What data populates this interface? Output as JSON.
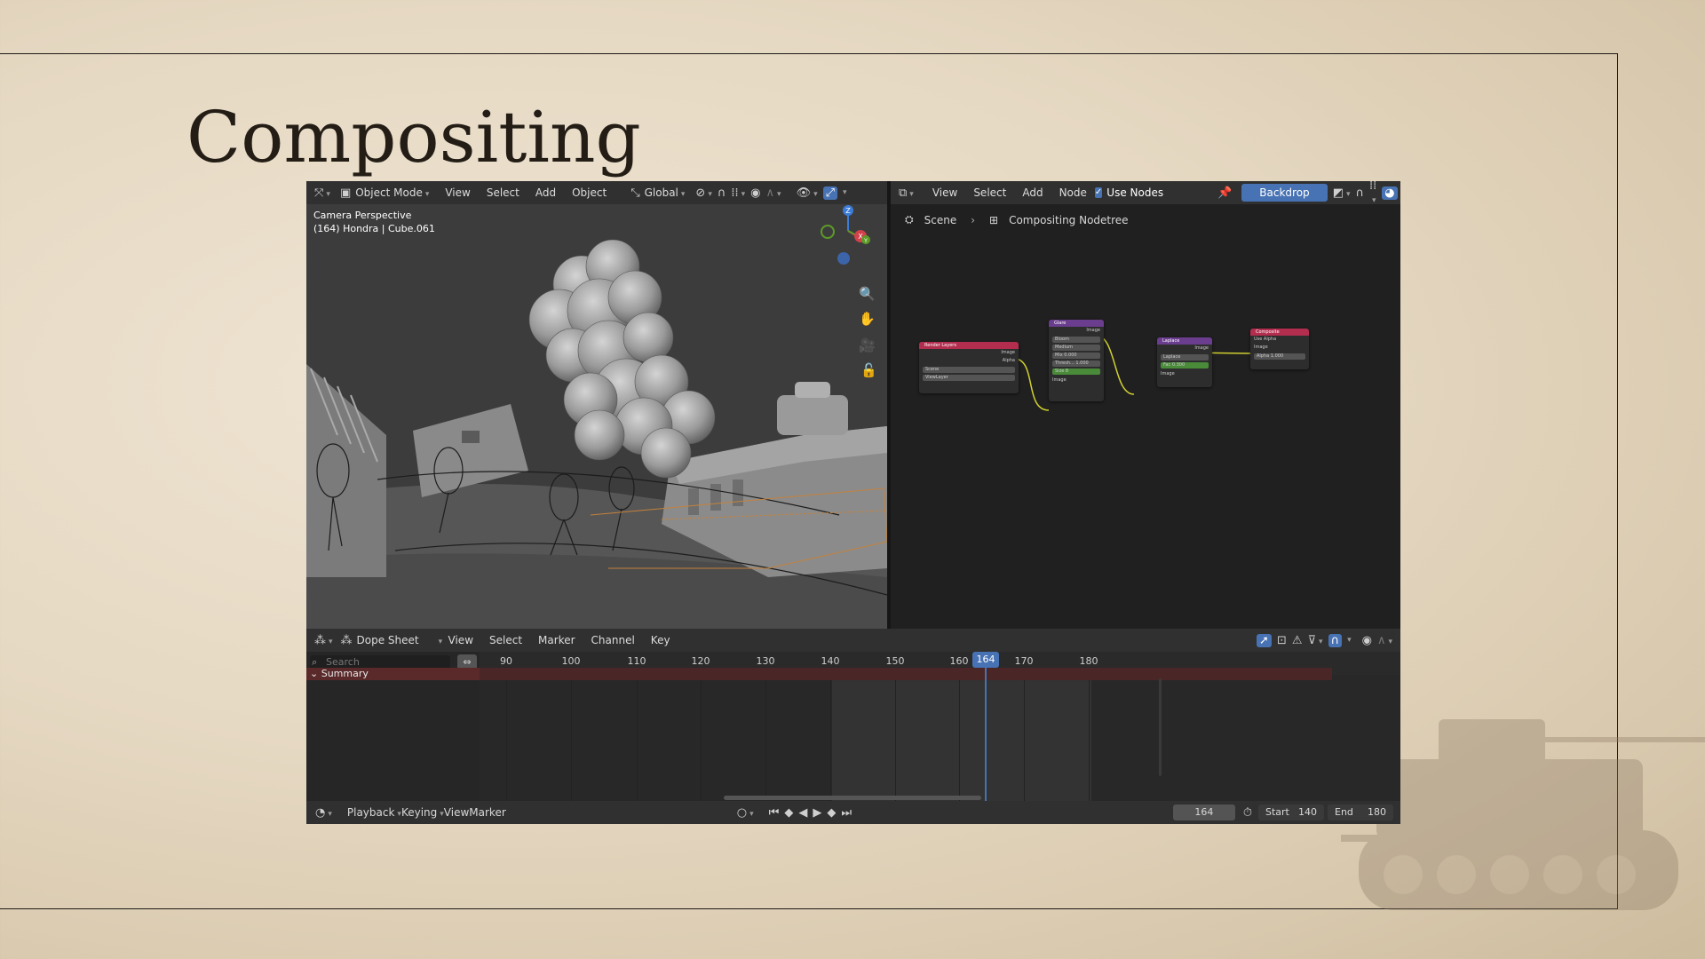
{
  "slide": {
    "title": "Compositing"
  },
  "viewport_header": {
    "mode": "Object Mode",
    "menus": [
      "View",
      "Select",
      "Add",
      "Object"
    ],
    "orientation": "Global"
  },
  "viewport": {
    "camera_label": "Camera Perspective",
    "object_label": "(164) Hondra | Cube.061",
    "gizmo": {
      "z": "Z",
      "x": "X",
      "y": "Y"
    }
  },
  "node_header": {
    "menus": [
      "View",
      "Select",
      "Add",
      "Node"
    ],
    "use_nodes_label": "Use Nodes",
    "backdrop_label": "Backdrop"
  },
  "breadcrumb": {
    "scene": "Scene",
    "nodetree": "Compositing Nodetree"
  },
  "nodes": {
    "render_layers": {
      "title": "Render Layers",
      "out1": "Image",
      "out2": "Alpha",
      "scene": "Scene",
      "layer": "ViewLayer"
    },
    "glare": {
      "title": "Glare",
      "out": "Image",
      "type": "Bloom",
      "quality": "Medium",
      "mix": "Mix",
      "mix_val": "0.000",
      "threshold": "Thresh...",
      "threshold_val": "1.000",
      "size": "Size",
      "size_val": "8",
      "in": "Image"
    },
    "laplace": {
      "title": "Laplace",
      "out": "Image",
      "type": "Laplace",
      "fac": "Fac",
      "fac_val": "0.300",
      "in": "Image"
    },
    "composite": {
      "title": "Composite",
      "use_alpha": "Use Alpha",
      "in1": "Image",
      "in2": "Alpha",
      "alpha_val": "1.000"
    }
  },
  "dope_header": {
    "editor": "Dope Sheet",
    "menus": [
      "View",
      "Select",
      "Marker",
      "Channel",
      "Key"
    ]
  },
  "dope": {
    "search_placeholder": "Search",
    "summary_label": "Summary",
    "ticks": [
      "90",
      "100",
      "110",
      "120",
      "130",
      "140",
      "150",
      "160",
      "170",
      "180"
    ],
    "current_frame": "164"
  },
  "timeline": {
    "menus": [
      "Playback",
      "Keying",
      "View",
      "Marker"
    ],
    "frame": "164",
    "start_label": "Start",
    "start": "140",
    "end_label": "End",
    "end": "180"
  },
  "colors": {
    "accent_blue": "#4772b3",
    "render_layers_header": "#b32d4e",
    "glare_header": "#6b3d8e",
    "laplace_header": "#6b3d8e",
    "composite_header": "#b32d4e",
    "link_yellow": "#cfcf30",
    "summary_row": "#5a2a2a"
  }
}
